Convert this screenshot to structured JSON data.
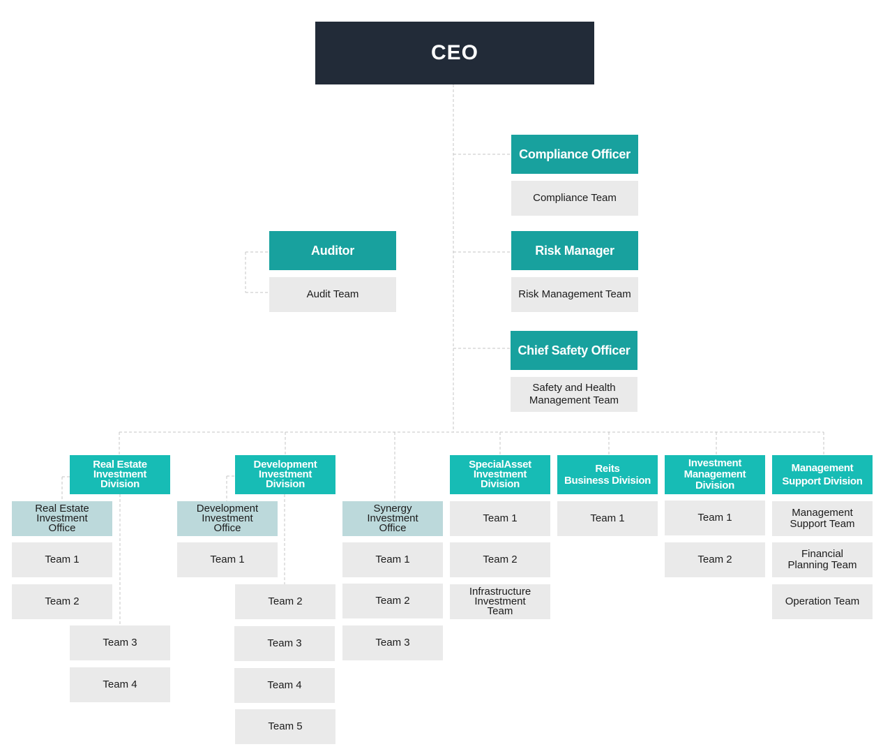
{
  "chart": {
    "ceo": "CEO",
    "officers": [
      {
        "title": "Compliance Officer",
        "team": "Compliance Team"
      },
      {
        "title": "Auditor",
        "team": "Audit Team"
      },
      {
        "title": "Risk Manager",
        "team": "Risk Management Team"
      },
      {
        "title": "Chief Safety Officer",
        "team": "Safety and Health\nManagement Team"
      }
    ],
    "divisions": [
      {
        "title": "Real Estate\nInvestment\nDivision",
        "office": "Real Estate\nInvestment\nOffice",
        "teams": [
          "Team 1",
          "Team 2",
          "Team 3",
          "Team 4"
        ]
      },
      {
        "title": "Development\nInvestment\nDivision",
        "office": "Development\nInvestment\nOffice",
        "teams": [
          "Team 1",
          "Team 2",
          "Team 3",
          "Team 4",
          "Team 5"
        ]
      },
      {
        "title": "",
        "office": "Synergy\nInvestment\nOffice",
        "teams": [
          "Team 1",
          "Team 2",
          "Team 3"
        ]
      },
      {
        "title": "SpecialAsset\nInvestment\nDivision",
        "teams": [
          "Team 1",
          "Team 2",
          "Infrastructure\nInvestment\nTeam"
        ]
      },
      {
        "title": "Reits\nBusiness Division",
        "teams": [
          "Team 1"
        ]
      },
      {
        "title": "Investment\nManagement\nDivision",
        "teams": [
          "Team 1",
          "Team 2"
        ]
      },
      {
        "title": "Management\nSupport Division",
        "teams": [
          "Management\nSupport Team",
          "Financial\nPlanning Team",
          "Operation Team"
        ]
      }
    ]
  },
  "colors": {
    "ceo": "#222b38",
    "officer": "#18a19e",
    "division": "#17bcb5",
    "office": "#bcd9db",
    "team": "#eaeaea",
    "connector": "#c4c4c4"
  }
}
